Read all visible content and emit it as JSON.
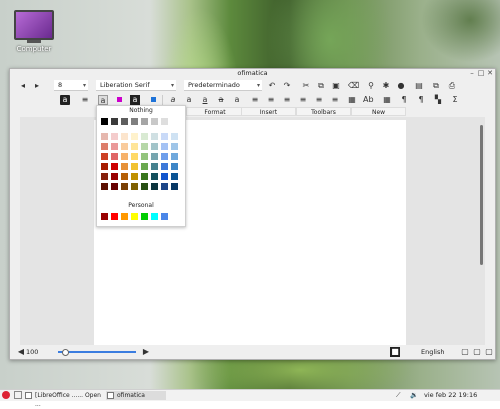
{
  "desktop": {
    "icon_label": "Computer"
  },
  "window": {
    "title": "ofimatica",
    "controls": {
      "minimize": "–",
      "maximize": "□",
      "close": "✕"
    }
  },
  "toolbar1": {
    "font_size": "8",
    "font_name": "Liberation Serif",
    "paragraph_style": "Predeterminado"
  },
  "menus": [
    "Format",
    "Insert",
    "Toolbars",
    "New"
  ],
  "palette": {
    "nothing_label": "Nothing",
    "personal_label": "Personal",
    "grays": [
      "#000000",
      "#3a3a3a",
      "#5e5e5e",
      "#7f7f7f",
      "#a5a5a5",
      "#c8c8c8",
      "#dedede",
      "#ffffff"
    ],
    "colors": [
      [
        "#e6b8af",
        "#f4cccc",
        "#fce5cd",
        "#fff2cc",
        "#d9ead3",
        "#d0e0e3",
        "#c9daf8",
        "#cfe2f3"
      ],
      [
        "#dd7e6b",
        "#ea9999",
        "#f9cb9c",
        "#ffe599",
        "#b6d7a8",
        "#a2c4c9",
        "#a4c2f4",
        "#9fc5e8"
      ],
      [
        "#cc4125",
        "#e06666",
        "#f6b26b",
        "#ffd966",
        "#93c47d",
        "#76a5af",
        "#6d9eeb",
        "#6fa8dc"
      ],
      [
        "#a61c00",
        "#cc0000",
        "#e69138",
        "#f1c232",
        "#6aa84f",
        "#45818e",
        "#3c78d8",
        "#3d85c6"
      ],
      [
        "#85200c",
        "#990000",
        "#b45f06",
        "#bf9000",
        "#38761d",
        "#134f5c",
        "#1155cc",
        "#0b5394"
      ],
      [
        "#5b0f00",
        "#660000",
        "#783f04",
        "#7f6000",
        "#274e13",
        "#0c343d",
        "#1c4587",
        "#073763"
      ]
    ],
    "personal": [
      "#990000",
      "#ff0000",
      "#ff9900",
      "#ffff00",
      "#00cc00",
      "#00ffff",
      "#4a86e8"
    ]
  },
  "status": {
    "zoom": "100",
    "language": "English"
  },
  "taskbar": {
    "tasks": [
      "[LibreOffice ...... Open ...",
      "ofimatica"
    ],
    "clock": "vie feb 22  19:16"
  },
  "colors": {
    "accent": "#3b7de0",
    "highlight_font_color": "#cc00cc"
  }
}
